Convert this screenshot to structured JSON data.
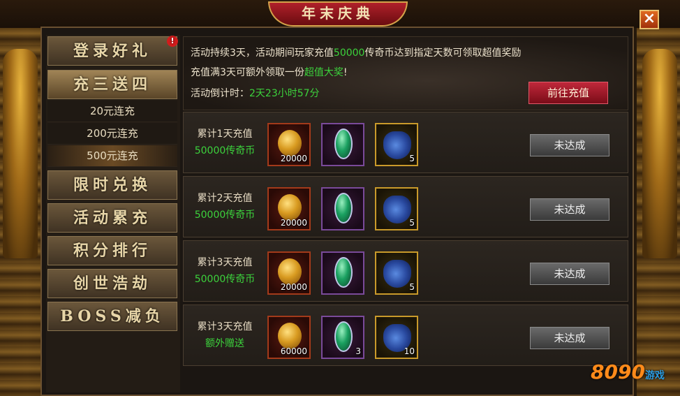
{
  "window": {
    "title": "年末庆典",
    "close_icon": "×"
  },
  "sidebar": {
    "items": [
      {
        "label": "登录好礼",
        "badge": "!"
      },
      {
        "label": "充三送四"
      },
      {
        "label": "限时兑换"
      },
      {
        "label": "活动累充"
      },
      {
        "label": "积分排行"
      },
      {
        "label": "创世浩劫"
      },
      {
        "label": "BOSS减负"
      }
    ],
    "subitems": [
      {
        "label": "20元连充"
      },
      {
        "label": "200元连充"
      },
      {
        "label": "500元连充",
        "selected": true
      }
    ]
  },
  "info": {
    "line1_prefix": "活动持续3天，活动期间玩家充值",
    "line1_amount": "50000",
    "line1_suffix": "传奇币达到指定天数可领取超值奖励",
    "line2_prefix": "充值满3天可额外领取一份",
    "line2_highlight": "超值大奖",
    "line2_suffix": "!",
    "countdown_label": "活动倒计时：",
    "countdown_value": "2天23小时57分",
    "recharge_button": "前往充值"
  },
  "rewards": [
    {
      "label": "累计1天充值",
      "sub": "50000传奇币",
      "coin_qty": "20000",
      "gem_qty": "",
      "bag_qty": "5",
      "button": "未达成"
    },
    {
      "label": "累计2天充值",
      "sub": "50000传奇币",
      "coin_qty": "20000",
      "gem_qty": "",
      "bag_qty": "5",
      "button": "未达成"
    },
    {
      "label": "累计3天充值",
      "sub": "50000传奇币",
      "coin_qty": "20000",
      "gem_qty": "",
      "bag_qty": "5",
      "button": "未达成"
    },
    {
      "label": "累计3天充值",
      "sub": "额外赠送",
      "coin_qty": "60000",
      "gem_qty": "3",
      "bag_qty": "10",
      "button": "未达成"
    }
  ],
  "watermark": {
    "text": "8090",
    "sub": "游戏"
  },
  "colors": {
    "accent_green": "#3cd23c",
    "accent_red": "#c0283a"
  }
}
